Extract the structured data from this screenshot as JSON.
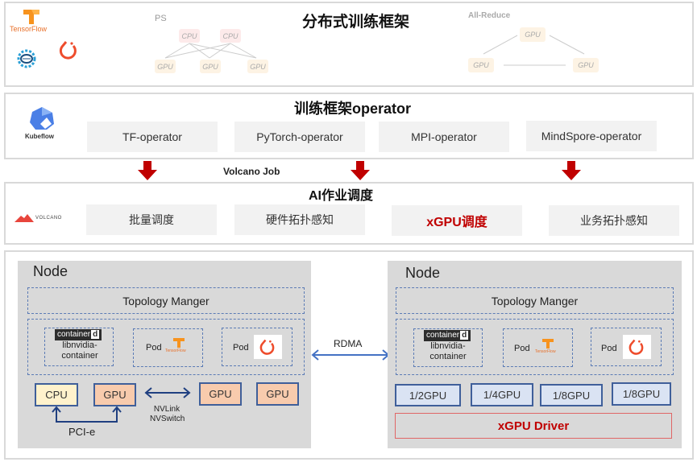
{
  "layer1": {
    "title": "分布式训练框架",
    "logos": [
      "tensorflow-logo",
      "kubeflow-logo",
      "pytorch-logo"
    ],
    "tensorflow_label": "TensorFlow",
    "ps": {
      "label": "PS",
      "cpu": [
        "CPU",
        "CPU"
      ],
      "gpu": [
        "GPU",
        "GPU",
        "GPU"
      ]
    },
    "allreduce": {
      "label": "All-Reduce",
      "gpu": [
        "GPU",
        "GPU",
        "GPU"
      ]
    }
  },
  "layer2": {
    "title": "训练框架operator",
    "logo_label": "Kubeflow",
    "operators": [
      "TF-operator",
      "PyTorch-operator",
      "MPI-operator",
      "MindSpore-operator"
    ]
  },
  "connector": {
    "label": "Volcano Job"
  },
  "layer3": {
    "title": "AI作业调度",
    "logo_label": "VOLCANO",
    "items": [
      "批量调度",
      "硬件拓扑感知",
      "xGPU调度",
      "业务拓扑感知"
    ],
    "highlight_color": "#c00000"
  },
  "layer4": {
    "link_label": "RDMA",
    "left_node": {
      "title": "Node",
      "topology": "Topology Manger",
      "containerd": "container",
      "containerd_d": "d",
      "libnvidia": [
        "libnvidia-",
        "container"
      ],
      "pods": [
        "Pod",
        "Pod"
      ],
      "chips": {
        "cpu": "CPU",
        "gpus": [
          "GPU",
          "GPU",
          "GPU"
        ]
      },
      "nvlink": [
        "NVLink",
        "NVSwitch"
      ],
      "pcie": "PCI-e"
    },
    "right_node": {
      "title": "Node",
      "topology": "Topology Manger",
      "containerd": "container",
      "containerd_d": "d",
      "libnvidia": [
        "libnvidia-",
        "container"
      ],
      "pods": [
        "Pod",
        "Pod"
      ],
      "vgpus": [
        "1/2GPU",
        "1/4GPU",
        "1/8GPU",
        "1/8GPU"
      ],
      "driver": "xGPU Driver"
    }
  },
  "colors": {
    "red_arrow": "#c00000",
    "cpu_fill": "#fff2cc",
    "gpu_fill": "#f8cbad",
    "vgpu_fill": "#dae3f3",
    "chip_border": "#3f5f9a",
    "driver_border": "#e06666",
    "rdma_arrow": "#4472c4"
  }
}
